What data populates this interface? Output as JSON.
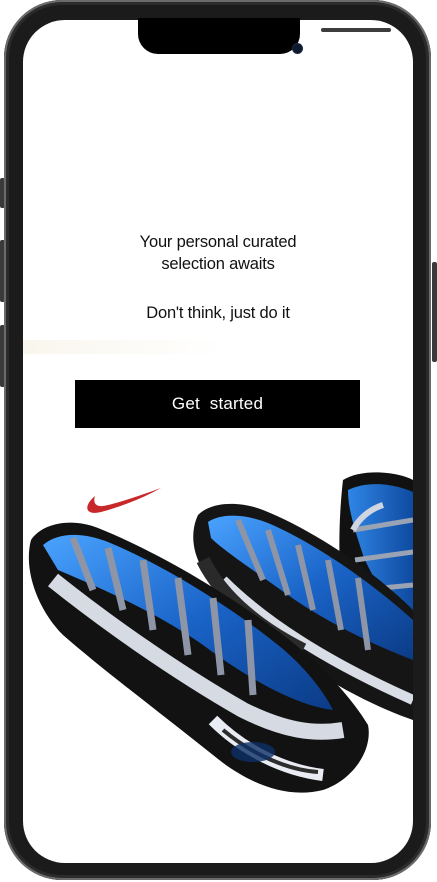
{
  "screen": {
    "headline": "Your personal curated\nselection awaits",
    "headline_line1": "Your personal curated",
    "headline_line2": "selection awaits",
    "tagline": "Don't think, just do it",
    "cta_label": "Get  started"
  },
  "hero_image": {
    "subject": "blue-sneakers-illustration",
    "logo": "swoosh-logo"
  },
  "colors": {
    "background": "#ffffff",
    "button": "#000000",
    "button_text": "#ffffff",
    "text": "#111111",
    "swoosh": "#c8282a",
    "shoe_blue": "#1f6fc4"
  }
}
